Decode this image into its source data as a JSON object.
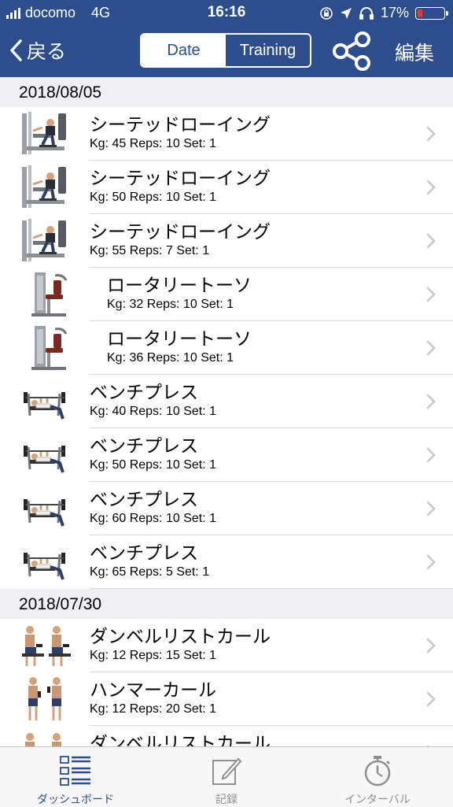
{
  "status": {
    "carrier": "docomo",
    "network": "4G",
    "time": "16:16",
    "battery": "17%",
    "battery_level": 0.17
  },
  "nav": {
    "back_label": "戻る",
    "segments": [
      {
        "label": "Date",
        "active": true
      },
      {
        "label": "Training",
        "active": false
      }
    ],
    "share_icon": "share-icon",
    "edit_label": "編集"
  },
  "colors": {
    "nav_bar": "#2e4d8c",
    "accent": "#2e4d8c",
    "battery_low": "#e03a3a"
  },
  "sections": [
    {
      "date": "2018/08/05",
      "rows": [
        {
          "name": "シーテッドローイング",
          "detail": "Kg: 45 Reps: 10 Set: 1",
          "image": "seated-row-machine",
          "indent": false
        },
        {
          "name": "シーテッドローイング",
          "detail": "Kg: 50 Reps: 10 Set: 1",
          "image": "seated-row-machine",
          "indent": false
        },
        {
          "name": "シーテッドローイング",
          "detail": "Kg: 55 Reps: 7 Set: 1",
          "image": "seated-row-machine",
          "indent": false
        },
        {
          "name": "ロータリートーソ",
          "detail": "Kg: 32 Reps: 10 Set: 1",
          "image": "rotary-torso-machine",
          "indent": true
        },
        {
          "name": "ロータリートーソ",
          "detail": "Kg: 36 Reps: 10 Set: 1",
          "image": "rotary-torso-machine",
          "indent": true
        },
        {
          "name": "ベンチプレス",
          "detail": "Kg: 40 Reps: 10 Set: 1",
          "image": "bench-press",
          "indent": false
        },
        {
          "name": "ベンチプレス",
          "detail": "Kg: 50 Reps: 10 Set: 1",
          "image": "bench-press",
          "indent": false
        },
        {
          "name": "ベンチプレス",
          "detail": "Kg: 60 Reps: 10 Set: 1",
          "image": "bench-press",
          "indent": false
        },
        {
          "name": "ベンチプレス",
          "detail": "Kg: 65 Reps: 5 Set: 1",
          "image": "bench-press",
          "indent": false
        }
      ]
    },
    {
      "date": "2018/07/30",
      "rows": [
        {
          "name": "ダンベルリストカール",
          "detail": "Kg: 12 Reps: 15 Set: 1",
          "image": "wrist-curl",
          "indent": false
        },
        {
          "name": "ハンマーカール",
          "detail": "Kg: 12 Reps: 20 Set: 1",
          "image": "hammer-curl",
          "indent": false
        },
        {
          "name": "ダンベルリストカール",
          "detail": "",
          "image": "wrist-curl",
          "indent": false
        }
      ]
    }
  ],
  "tabs": [
    {
      "label": "ダッシュボード",
      "icon": "dashboard-icon",
      "active": true
    },
    {
      "label": "記録",
      "icon": "pencil-icon",
      "active": false
    },
    {
      "label": "インターバル",
      "icon": "stopwatch-icon",
      "active": false
    }
  ]
}
